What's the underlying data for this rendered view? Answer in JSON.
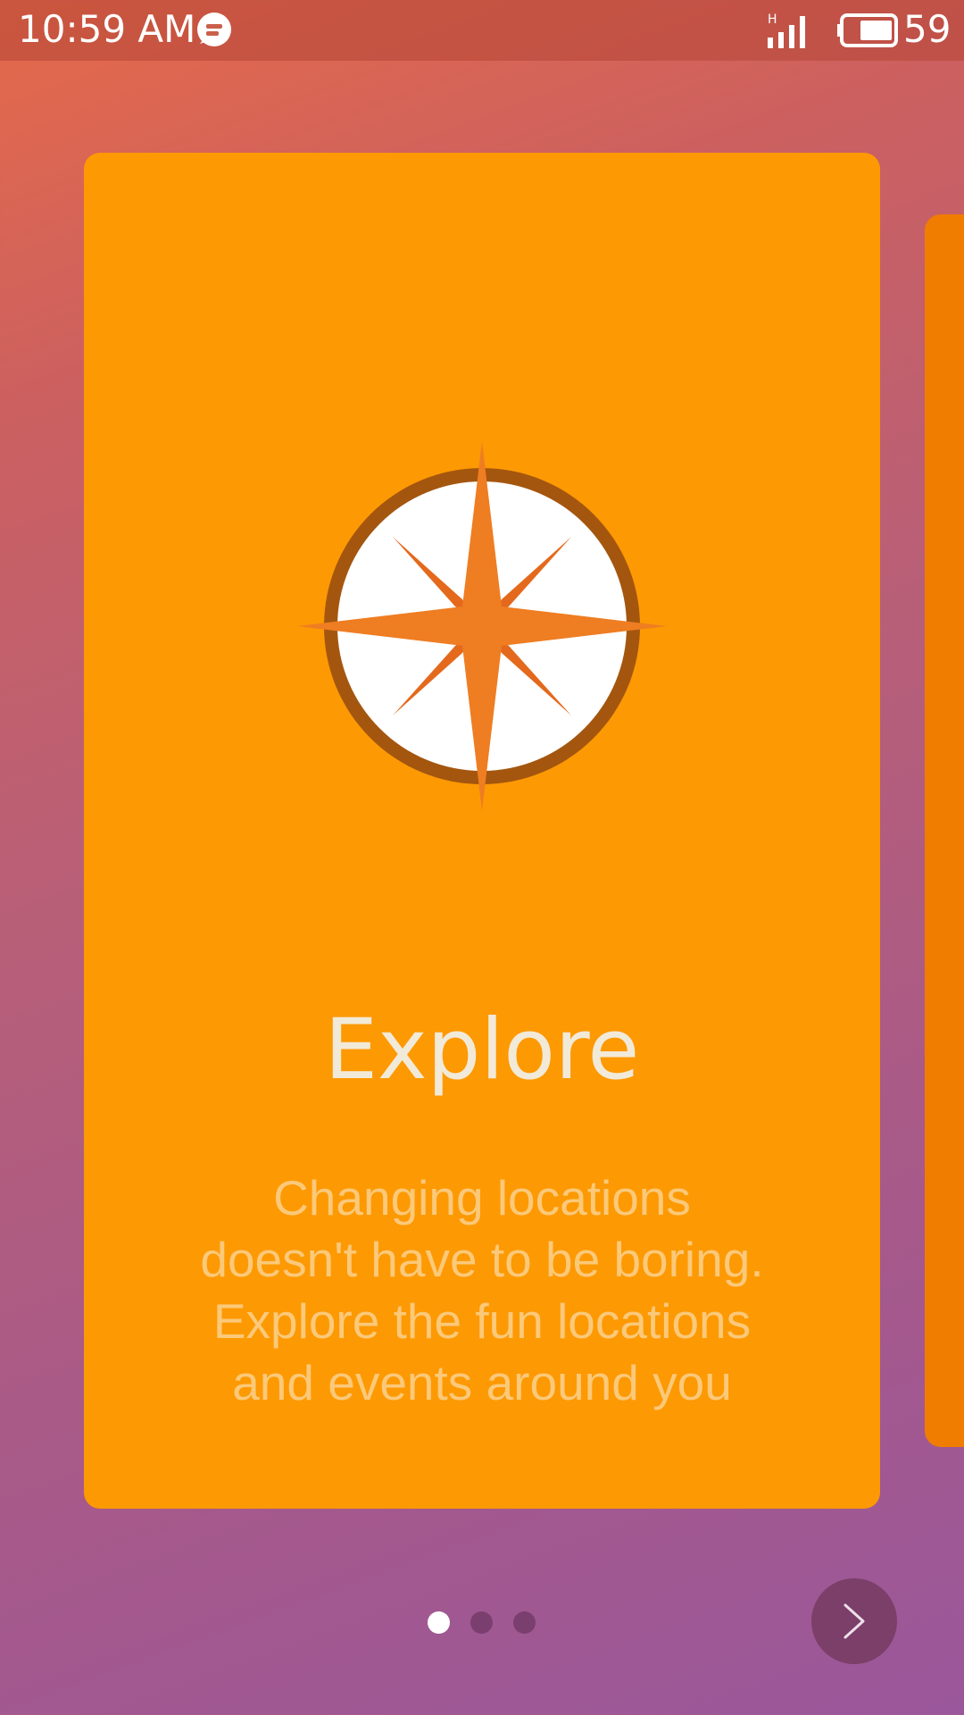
{
  "status_bar": {
    "time": "10:59 AM",
    "network_type": "H",
    "battery_level": "59"
  },
  "card": {
    "icon": "compass-icon",
    "title": "Explore",
    "description": "Changing locations doesn't have to be boring. Explore the fun locations and events around you"
  },
  "pager": {
    "page_count": 3,
    "active_index": 0
  },
  "next_button": {
    "icon": "chevron-right-icon"
  },
  "colors": {
    "card": "#fd9903",
    "next_card": "#f07c00",
    "compass_ring": "#a4560f",
    "compass_star": "#ef7d22",
    "title_text": "#f2ead8",
    "description_text": "#fbc979"
  }
}
